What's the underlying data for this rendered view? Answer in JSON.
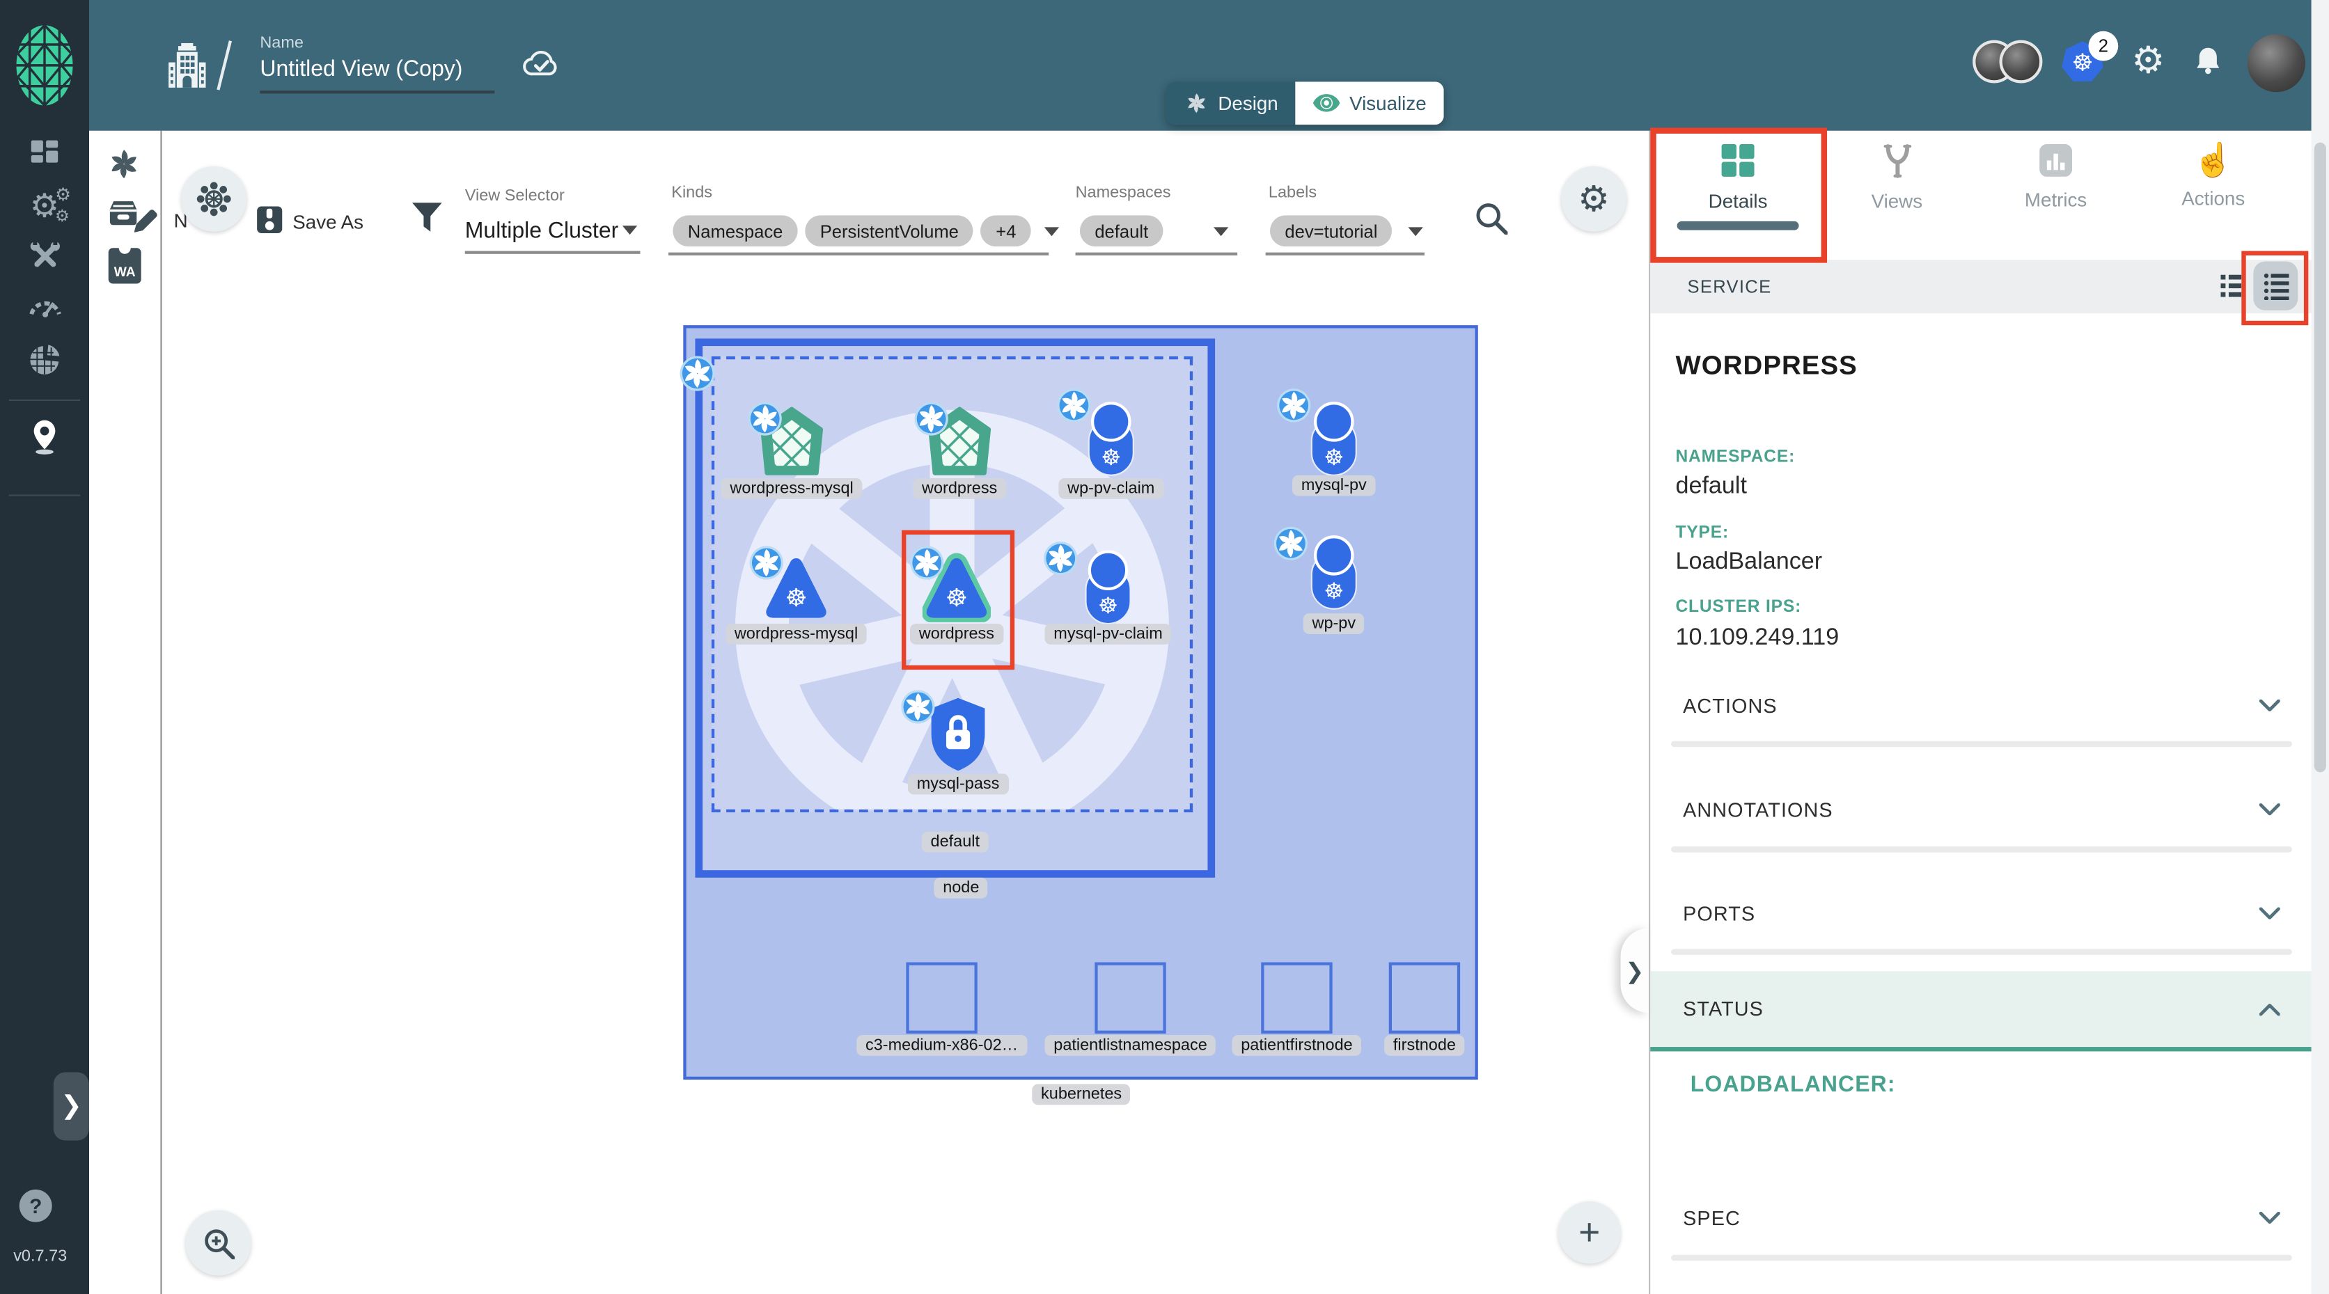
{
  "colors": {
    "accent_teal": "#49a28d",
    "header_teal": "#3c6879",
    "sidebar_dark": "#243039",
    "k8s_blue": "#326CE5",
    "selection_red": "#e8432a",
    "cluster_fill": "#b0c0ec",
    "node_fill": "#c8d2f0",
    "tab_underline": "#546e7a"
  },
  "header": {
    "name_label": "Name",
    "view_name": "Untitled View (Copy)",
    "design_label": "Design",
    "visualize_label": "Visualize",
    "k8s_context_badge": "2"
  },
  "toolbar": {
    "occluded_label": "N",
    "save_as_label": "Save As",
    "view_selector_label": "View Selector",
    "view_selector_value": "Multiple Cluster",
    "kinds_label": "Kinds",
    "kind_chips": [
      "Namespace",
      "PersistentVolume",
      "+4"
    ],
    "namespaces_label": "Namespaces",
    "namespaces_value": "default",
    "labels_label": "Labels",
    "labels_value": "dev=tutorial"
  },
  "sidebar": {
    "version": "v0.7.73",
    "help": "?"
  },
  "subbar": {
    "wasm_label": "WA"
  },
  "panel": {
    "tabs": [
      "Details",
      "Views",
      "Metrics",
      "Actions"
    ],
    "kind_header": "SERVICE",
    "title": "WORDPRESS",
    "fields": [
      {
        "label": "NAMESPACE:",
        "value": "default"
      },
      {
        "label": "TYPE:",
        "value": "LoadBalancer"
      },
      {
        "label": "CLUSTER IPS:",
        "value": "10.109.249.119"
      }
    ],
    "sections": [
      "ACTIONS",
      "ANNOTATIONS",
      "PORTS",
      "STATUS",
      "SPEC"
    ],
    "status_content": "LOADBALANCER:"
  },
  "canvas": {
    "cluster_label": "kubernetes",
    "node_label": "node",
    "namespace_label": "default",
    "plus_label": "+",
    "nodes": {
      "deploy1": "wordpress-mysql",
      "deploy2": "wordpress",
      "pvc1": "wp-pv-claim",
      "pv1": "mysql-pv",
      "svc1": "wordpress-mysql",
      "svc2": "wordpress",
      "pvc2": "mysql-pv-claim",
      "pv2": "wp-pv",
      "secret": "mysql-pass",
      "host1": "c3-medium-x86-02…",
      "host2": "patientlistnamespace",
      "host3": "patientfirstnode",
      "host4": "firstnode"
    }
  }
}
